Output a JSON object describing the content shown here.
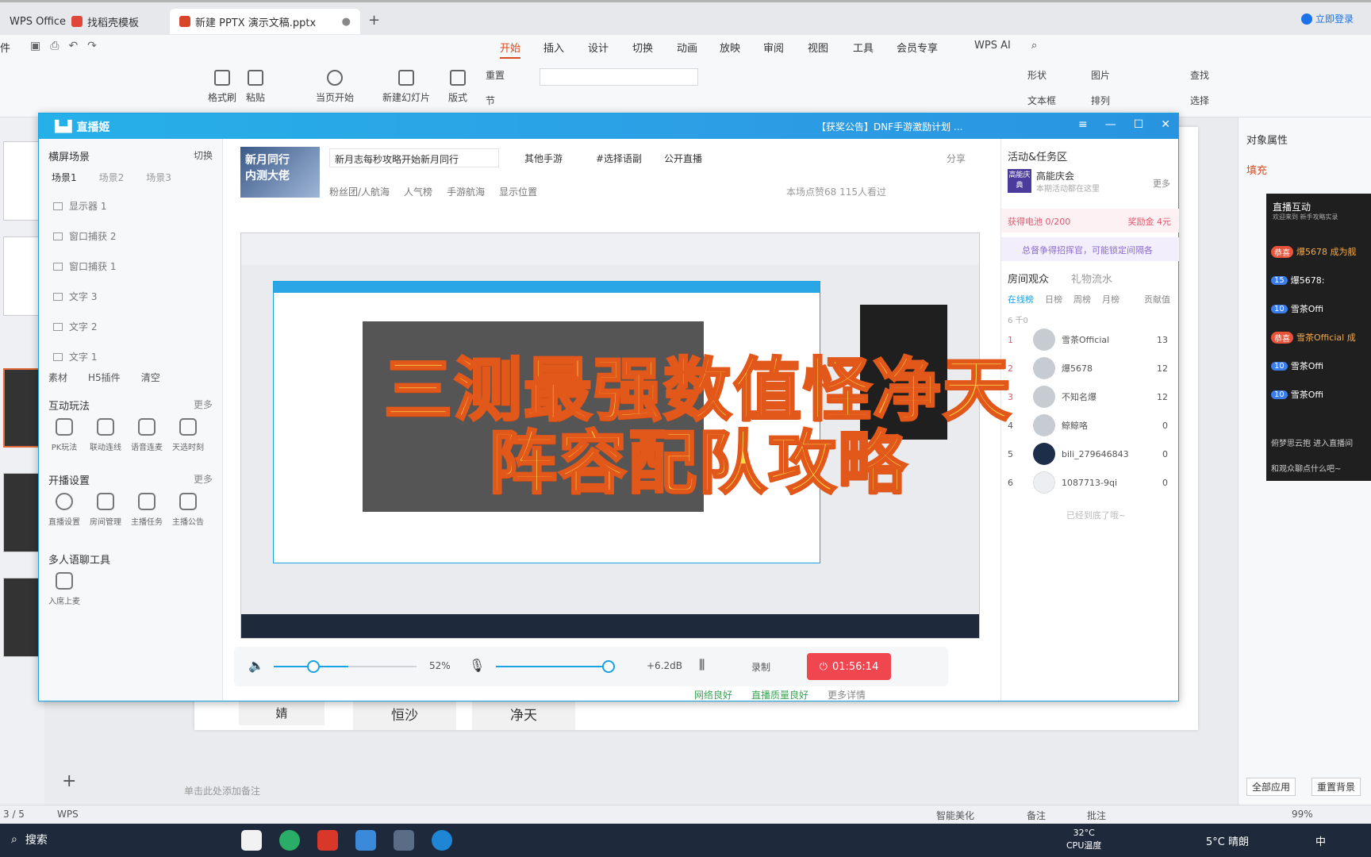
{
  "wps": {
    "tabs": [
      {
        "label": "WPS Office"
      },
      {
        "label": "找稻壳模板"
      },
      {
        "label": "新建 PPTX 演示文稿.pptx"
      }
    ],
    "file_label": "件",
    "menu": [
      "开始",
      "插入",
      "设计",
      "切换",
      "动画",
      "放映",
      "审阅",
      "视图",
      "工具",
      "会员专享"
    ],
    "wps_ai": "WPS AI",
    "login": "立即登录",
    "ribbon": {
      "format_brush": "格式刷",
      "paste": "粘贴",
      "play_from_current": "当页开始",
      "new_slide": "新建幻灯片",
      "layout": "版式",
      "reset": "重置",
      "section": "节",
      "shape": "形状",
      "image": "图片",
      "textbox": "文本框",
      "arrange": "排列",
      "find": "查找",
      "select": "选择"
    }
  },
  "right_panel": {
    "title": "对象属性",
    "fill": "填充",
    "apply_all": "全部应用",
    "reset_bg": "重置背景"
  },
  "slide": {
    "labels": [
      "婧",
      "恒沙",
      "净天"
    ],
    "note_placeholder": "单击此处添加备注"
  },
  "bili": {
    "logo": "直播姬",
    "announcement": "【获奖公告】DNF手游激励计划 ...",
    "left": {
      "header": "横屏场景",
      "switch": "切换",
      "scenes": [
        "场景1",
        "场景2",
        "场景3"
      ],
      "sources": [
        "显示器 1",
        "窗口捕获 2",
        "窗口捕获 1",
        "文字 3",
        "文字 2",
        "文字 1"
      ],
      "bottom_tools": [
        "素材",
        "H5插件",
        "清空"
      ],
      "interactive_title": "互动玩法",
      "interactive_more": "更多",
      "interactive_tools": [
        "PK玩法",
        "联动连线",
        "语音连麦",
        "天选时刻"
      ],
      "broadcast_title": "开播设置",
      "broadcast_more": "更多",
      "broadcast_tools": [
        "直播设置",
        "房间管理",
        "主播任务",
        "主播公告"
      ],
      "multi_title": "多人语聊工具",
      "multi_tools": [
        "入席上麦"
      ]
    },
    "center": {
      "room_title": "新月志每秒攻略开始新月同行",
      "category": "其他手游",
      "tag": "#选择语副",
      "public_live": "公开直播",
      "share": "分享",
      "fans_rank": "粉丝团/人航海",
      "popularity": "人气榜",
      "mobile_rank": "手游航海",
      "show_location": "显示位置",
      "stats": "本场点赞68  115人看过",
      "banner_line1": "新月同行",
      "banner_line2": "内测大佬",
      "volume_pct": "52%",
      "mic_gain": "+6.2dB",
      "record": "录制",
      "live_timer": "01:56:14",
      "net_status": "网络良好",
      "live_quality": "直播质量良好",
      "more_details": "更多详情"
    },
    "right": {
      "activity_title": "活动&任务区",
      "event_badge": "高能庆典",
      "event_title": "高能庆会",
      "event_sub": "本期活动都在这里",
      "more": "更多",
      "battery": "获得电池  0/200",
      "reward": "奖励金 4元",
      "promo": "总督争得招挥官，可能锁定间隔各",
      "audience_title": "房间观众",
      "gift_flow": "礼物流水",
      "audience_tabs": [
        "在线榜",
        "日榜",
        "周榜",
        "月榜"
      ],
      "contribution": "贡献值",
      "online_count": "6 千0",
      "viewers": [
        {
          "rank": "1",
          "name": "雪茶Official",
          "score": "13"
        },
        {
          "rank": "2",
          "name": "爆5678",
          "score": "12"
        },
        {
          "rank": "3",
          "name": "不知名爆",
          "score": "12"
        },
        {
          "rank": "4",
          "name": "鲸鲸咯",
          "score": "0"
        },
        {
          "rank": "5",
          "name": "bili_279646843",
          "score": "0"
        },
        {
          "rank": "6",
          "name": "1087713-9qi",
          "score": "0"
        }
      ],
      "end": "已经到底了哦~"
    }
  },
  "overlay": {
    "line1": "三测最强数值怪净天",
    "line2": "阵容配队攻略"
  },
  "live_panel": {
    "title": "直播互动",
    "sub": "欢迎来到 新手攻略实录",
    "messages": [
      {
        "tag": "恭喜",
        "text": "爆5678 成为舰"
      },
      {
        "tag": "15",
        "text": "爆5678:"
      },
      {
        "tag": "10",
        "text": "雪茶Offi"
      },
      {
        "tag": "恭喜",
        "text": "雪茶Official 成"
      },
      {
        "tag": "10",
        "text": "雪茶Offi"
      },
      {
        "tag": "10",
        "text": "雪茶Offi"
      }
    ],
    "footer1": "俯梦思云抱 进入直播间",
    "footer2": "和观众聊点什么吧~"
  },
  "status": {
    "page": "3 / 5",
    "wps": "WPS",
    "smart": "智能美化",
    "notes": "备注",
    "comment": "批注",
    "zoom": "99%"
  },
  "taskbar": {
    "search": "搜索",
    "temp": "32°C",
    "cpu": "CPU温度",
    "weather": "5°C 晴朗",
    "ime": "中"
  }
}
